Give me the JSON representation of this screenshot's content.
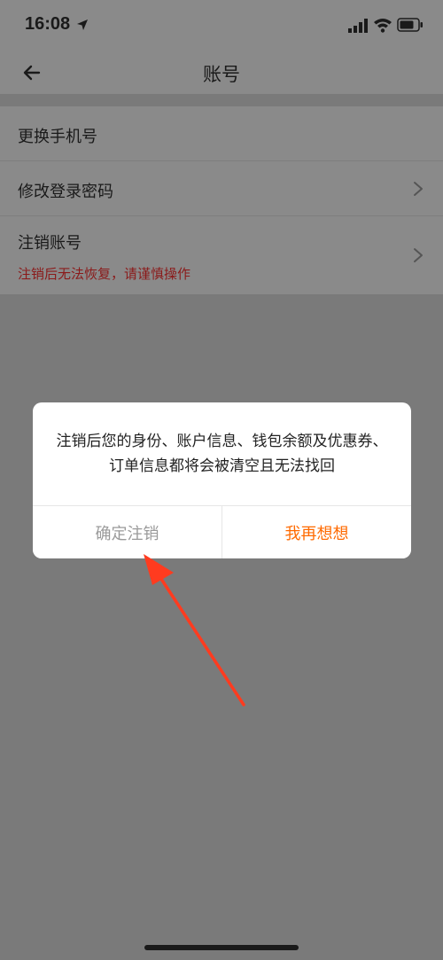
{
  "status_bar": {
    "time": "16:08"
  },
  "header": {
    "title": "账号"
  },
  "list": {
    "items": [
      {
        "label": "更换手机号"
      },
      {
        "label": "修改登录密码"
      },
      {
        "label": "注销账号",
        "warning": "注销后无法恢复，请谨慎操作"
      }
    ]
  },
  "dialog": {
    "message": "注销后您的身份、账户信息、钱包余额及优惠券、订单信息都将会被清空且无法找回",
    "confirm_label": "确定注销",
    "cancel_label": "我再想想"
  },
  "colors": {
    "accent": "#ff6a00",
    "warning": "#8b1a1a",
    "overlay": "#7a7a7a",
    "annotation": "#ff3b1f"
  },
  "icons": [
    "location-arrow-icon",
    "signal-icon",
    "wifi-icon",
    "battery-icon",
    "back-arrow-icon",
    "chevron-right-icon"
  ]
}
